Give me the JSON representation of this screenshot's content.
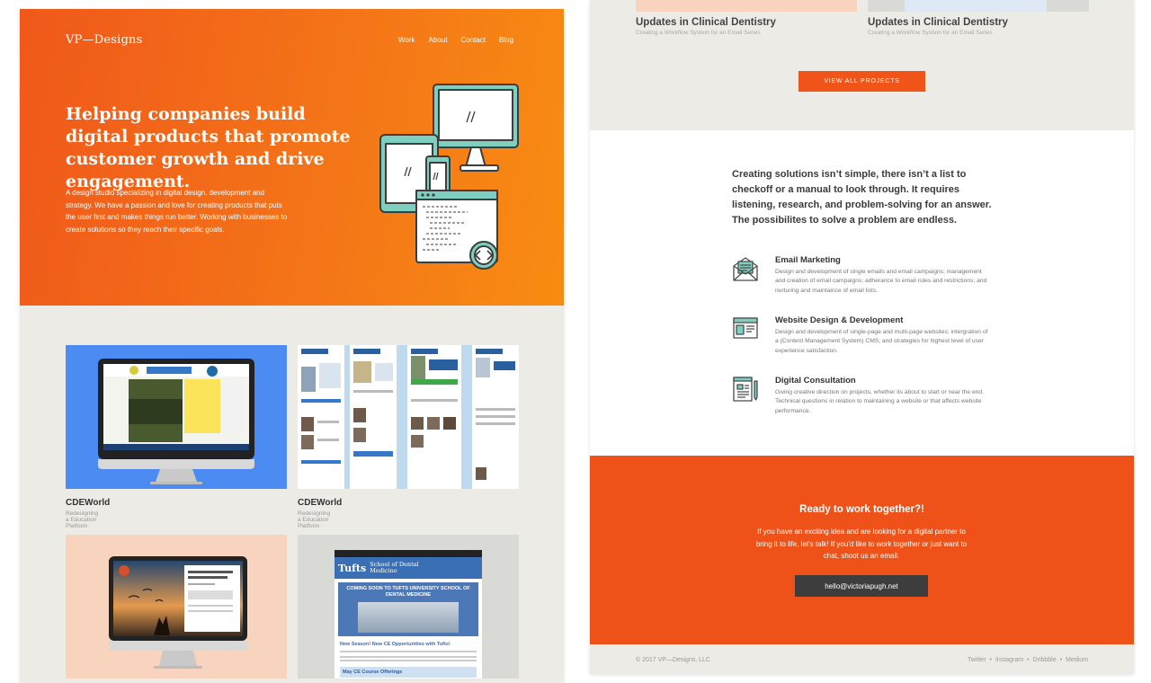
{
  "site": {
    "logo": "VP—Designs",
    "nav": [
      "Work",
      "About",
      "Contact",
      "Blog"
    ]
  },
  "hero": {
    "headline": "Helping companies build digital products that promote customer growth and drive engagement.",
    "body": "A design studio specializing in digital design, development and strategy. We have a passion and love for creating products that puts the user first and makes things run better. Working with businesses to create solutions so they reach their specific goals."
  },
  "projects": [
    {
      "title": "CDEWorld",
      "subtitle": "Redesigning a Education Platform"
    },
    {
      "title": "CDEWorld",
      "subtitle": "Redesigning a Education Platform"
    },
    {
      "title": "Updates in Clinical Dentistry",
      "subtitle": "Creating a Workflow System for an Email Series"
    },
    {
      "title": "Updates in Clinical Dentistry",
      "subtitle": "Creating a Workflow System for an Email Series"
    }
  ],
  "tufts_email": {
    "brand": "Tufts",
    "school": "School of Dental Medicine",
    "banner": "COMING SOON TO TUFTS UNIVERSITY SCHOOL OF DENTAL MEDICINE",
    "headline": "New Season! New CE Opportunities with Tufts!",
    "section": "May CE Course Offerings"
  },
  "view_all_label": "VIEW ALL PROJECTS",
  "intro": "Creating solutions isn’t simple, there isn’t a list to checkoff or a manual to look through. It requires listening, research, and problem-solving for an answer. The possibilites to solve a problem are endless.",
  "services": [
    {
      "title": "Email Marketing",
      "icon": "email-envelope-icon",
      "desc": "Design and development of single emails and email campaigns; management and creation of email campaigns; adherance to email rules and restrictions; and nurturing and maintaince of email lists."
    },
    {
      "title": "Website Design & Development",
      "icon": "browser-window-icon",
      "desc": "Design and development of single-page and multi-page websites; intergration of a (Content Management System) CMS; and strategies for highest level of user experience satisfaction."
    },
    {
      "title": "Digital Consultation",
      "icon": "document-pen-icon",
      "desc": "Giving creative direction on projects, whether its about to start or near the end. Technical questions in relation to maintaining a website or that affects website performance."
    }
  ],
  "cta": {
    "title": "Ready to work together?!",
    "body": "If you have an exciting idea and are looking for a digital partner to bring it to life, let's talk! If you'd like to work together or just want to chat, shoot us an email.",
    "email": "hello@victoriapugh.net"
  },
  "footer": {
    "copyright": "© 2017 VP—Designs, LLC",
    "social": [
      "Twitter",
      "Instagram",
      "Dribbble",
      "Medium"
    ],
    "separator": "•"
  },
  "colors": {
    "accent": "#f15419",
    "hero_start": "#f0581a",
    "hero_end": "#f88c12",
    "dark_button": "#3d3d3d",
    "icon_teal": "#7ecfbf"
  }
}
